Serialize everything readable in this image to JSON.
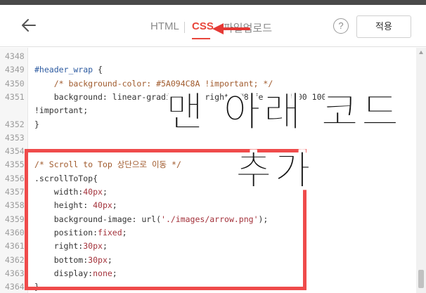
{
  "toolbar": {
    "tabs": {
      "html": "HTML",
      "css": "CSS",
      "upload": "파일업로드"
    },
    "help_label": "?",
    "apply_label": "적용",
    "back_icon": "arrow-left-icon"
  },
  "editor": {
    "lines": [
      {
        "num": "4348",
        "parts": []
      },
      {
        "num": "4349",
        "parts": [
          {
            "t": "#header_wrap",
            "c": "sel"
          },
          {
            "t": " {",
            "c": "prop"
          }
        ]
      },
      {
        "num": "4350",
        "parts": [
          {
            "t": "    /* background-color: #5A094C8A !important; */",
            "c": "cmt"
          }
        ]
      },
      {
        "num": "4351",
        "parts": [
          {
            "t": "    background: linear-gradient(to right, #8afe 2%, #000 100%)",
            "c": "prop"
          }
        ]
      },
      {
        "num": "",
        "parts": [
          {
            "t": "!important;",
            "c": "prop"
          }
        ]
      },
      {
        "num": "4352",
        "parts": [
          {
            "t": "}",
            "c": "prop"
          }
        ]
      },
      {
        "num": "4353",
        "parts": []
      },
      {
        "num": "4354",
        "parts": []
      },
      {
        "num": "4355",
        "parts": [
          {
            "t": "/* Scroll to Top 상단으로 이동 */",
            "c": "cmt"
          }
        ]
      },
      {
        "num": "4356",
        "parts": [
          {
            "t": ".scrollToTop{",
            "c": "prop"
          }
        ]
      },
      {
        "num": "4357",
        "parts": [
          {
            "t": "    width:",
            "c": "prop"
          },
          {
            "t": "40px",
            "c": "val"
          },
          {
            "t": ";",
            "c": "prop"
          }
        ]
      },
      {
        "num": "4358",
        "parts": [
          {
            "t": "    height: ",
            "c": "prop"
          },
          {
            "t": "40px",
            "c": "val"
          },
          {
            "t": ";",
            "c": "prop"
          }
        ]
      },
      {
        "num": "4359",
        "parts": [
          {
            "t": "    background-image: url(",
            "c": "prop"
          },
          {
            "t": "'./images/arrow.png'",
            "c": "val"
          },
          {
            "t": ");",
            "c": "prop"
          }
        ]
      },
      {
        "num": "4360",
        "parts": [
          {
            "t": "    position:",
            "c": "prop"
          },
          {
            "t": "fixed",
            "c": "val"
          },
          {
            "t": ";",
            "c": "prop"
          }
        ]
      },
      {
        "num": "4361",
        "parts": [
          {
            "t": "    right:",
            "c": "prop"
          },
          {
            "t": "30px",
            "c": "val"
          },
          {
            "t": ";",
            "c": "prop"
          }
        ]
      },
      {
        "num": "4362",
        "parts": [
          {
            "t": "    bottom:",
            "c": "prop"
          },
          {
            "t": "30px",
            "c": "val"
          },
          {
            "t": ";",
            "c": "prop"
          }
        ]
      },
      {
        "num": "4363",
        "parts": [
          {
            "t": "    display:",
            "c": "prop"
          },
          {
            "t": "none",
            "c": "val"
          },
          {
            "t": ";",
            "c": "prop"
          }
        ]
      },
      {
        "num": "4364",
        "parts": [
          {
            "t": "}",
            "c": "prop"
          }
        ]
      }
    ]
  },
  "annotation": {
    "line1": "맨 아래 코드",
    "line2": "추가",
    "highlight_color": "#ef4b4b"
  }
}
